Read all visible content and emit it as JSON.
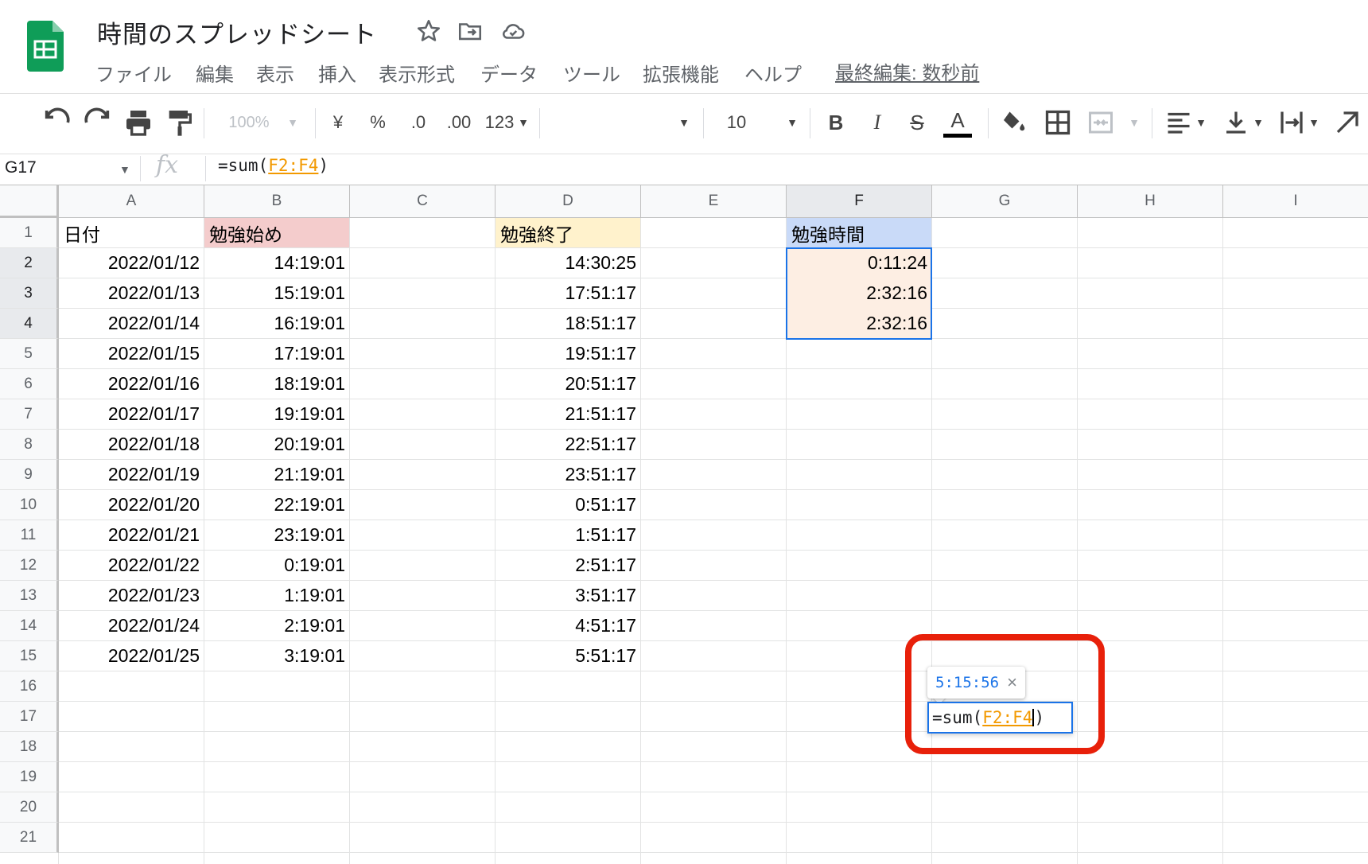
{
  "app": {
    "title": "時間のスプレッドシート",
    "last_edit": "最終編集: 数秒前",
    "brand_color": "#0f9d58"
  },
  "menu": [
    "ファイル",
    "編集",
    "表示",
    "挿入",
    "表示形式",
    "データ",
    "ツール",
    "拡張機能",
    "ヘルプ"
  ],
  "toolbar": {
    "zoom": "100%",
    "currency": "¥",
    "percent": "%",
    "dec_decrease": ".0",
    "dec_increase": ".00",
    "number_format": "123",
    "font_family": "",
    "font_size": "10",
    "bold": "B",
    "italic": "I",
    "strike": "S",
    "text_color": "A"
  },
  "formula_bar": {
    "name_box": "G17",
    "fx": "fx",
    "formula_prefix": "=sum(",
    "formula_ref": "F2:F4",
    "formula_suffix": ")"
  },
  "sheet": {
    "columns": [
      "A",
      "B",
      "C",
      "D",
      "E",
      "F",
      "G",
      "H",
      "I"
    ],
    "rows": [
      "1",
      "2",
      "3",
      "4",
      "5",
      "6",
      "7",
      "8",
      "9",
      "10",
      "11",
      "12",
      "13",
      "14",
      "15",
      "16",
      "17",
      "18",
      "19",
      "20",
      "21"
    ],
    "header_row": {
      "A": "日付",
      "B": "勉強始め",
      "D": "勉強終了",
      "F": "勉強時間"
    },
    "data_rows": [
      {
        "A": "2022/01/12",
        "B": "14:19:01",
        "D": "14:30:25",
        "F": "0:11:24"
      },
      {
        "A": "2022/01/13",
        "B": "15:19:01",
        "D": "17:51:17",
        "F": "2:32:16"
      },
      {
        "A": "2022/01/14",
        "B": "16:19:01",
        "D": "18:51:17",
        "F": "2:32:16"
      },
      {
        "A": "2022/01/15",
        "B": "17:19:01",
        "D": "19:51:17",
        "F": ""
      },
      {
        "A": "2022/01/16",
        "B": "18:19:01",
        "D": "20:51:17",
        "F": ""
      },
      {
        "A": "2022/01/17",
        "B": "19:19:01",
        "D": "21:51:17",
        "F": ""
      },
      {
        "A": "2022/01/18",
        "B": "20:19:01",
        "D": "22:51:17",
        "F": ""
      },
      {
        "A": "2022/01/19",
        "B": "21:19:01",
        "D": "23:51:17",
        "F": ""
      },
      {
        "A": "2022/01/20",
        "B": "22:19:01",
        "D": "0:51:17",
        "F": ""
      },
      {
        "A": "2022/01/21",
        "B": "23:19:01",
        "D": "1:51:17",
        "F": ""
      },
      {
        "A": "2022/01/22",
        "B": "0:19:01",
        "D": "2:51:17",
        "F": ""
      },
      {
        "A": "2022/01/23",
        "B": "1:19:01",
        "D": "3:51:17",
        "F": ""
      },
      {
        "A": "2022/01/24",
        "B": "2:19:01",
        "D": "4:51:17",
        "F": ""
      },
      {
        "A": "2022/01/25",
        "B": "3:19:01",
        "D": "5:51:17",
        "F": ""
      }
    ],
    "header_colors": {
      "B": "#f4cccc",
      "D": "#fff2cc",
      "F": "#c9daf8"
    },
    "range_fill": "#fdeee3",
    "active_cell": "G17"
  },
  "editor": {
    "prefix": "=sum(",
    "ref": "F2:F4",
    "suffix": ")",
    "preview_value": "5:15:56",
    "preview_close": "×"
  },
  "highlight_color": "#e8200a"
}
